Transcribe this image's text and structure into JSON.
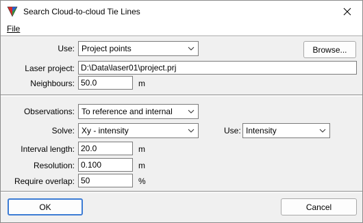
{
  "window": {
    "title": "Search Cloud-to-cloud Tie Lines"
  },
  "menu": {
    "file": "File"
  },
  "section1": {
    "use_label": "Use:",
    "use_value": "Project points",
    "browse_label": "Browse...",
    "laser_project_label": "Laser project:",
    "laser_project_value": "D:\\Data\\laser01\\project.prj",
    "neighbours_label": "Neighbours:",
    "neighbours_value": "50.0",
    "neighbours_unit": "m"
  },
  "section2": {
    "observations_label": "Observations:",
    "observations_value": "To reference and internal",
    "solve_label": "Solve:",
    "solve_value": "Xy - intensity",
    "use_label": "Use:",
    "use_value": "Intensity",
    "interval_length_label": "Interval length:",
    "interval_length_value": "20.0",
    "interval_length_unit": "m",
    "resolution_label": "Resolution:",
    "resolution_value": "0.100",
    "resolution_unit": "m",
    "require_overlap_label": "Require overlap:",
    "require_overlap_value": "50",
    "require_overlap_unit": "%"
  },
  "footer": {
    "ok_label": "OK",
    "cancel_label": "Cancel"
  },
  "icons": {
    "app": "tri-color-triangle-icon",
    "close": "close-icon",
    "dropdown": "chevron-down-icon"
  }
}
